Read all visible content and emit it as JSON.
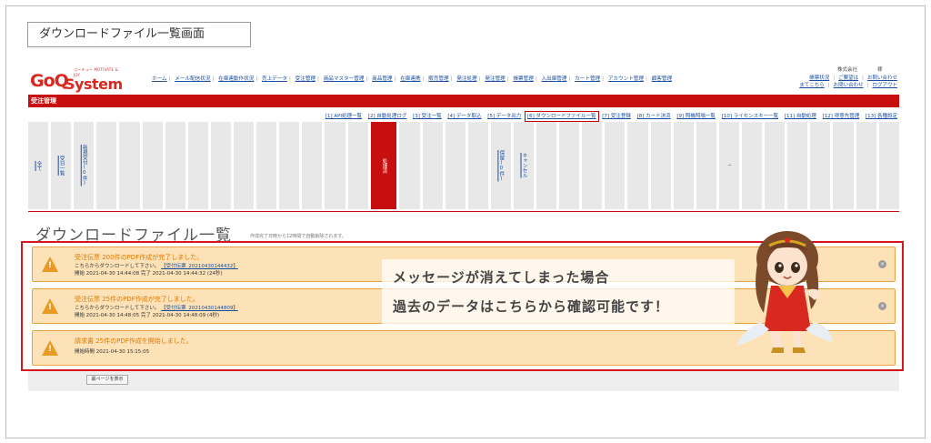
{
  "title": "ダウンロードファイル一覧画面",
  "logo": {
    "text_goq": "GoQ",
    "text_system": "System",
    "tagline": "ゴーキュー  MOTIVATE & JOY"
  },
  "top_nav": [
    "ホーム",
    "メール配信状況",
    "在庫連動作状況",
    "売上データ",
    "受注管理",
    "商品マスター管理",
    "商品管理",
    "在庫連携",
    "販売管理",
    "発注処理",
    "発注管理",
    "帳票管理",
    "入出庫管理",
    "カート管理",
    "アカウント管理",
    "顧客管理"
  ],
  "company": "株式会社　　　　様",
  "right_links": {
    "row1": [
      "帳票状況",
      "ご要望は",
      "お問い合わせ"
    ],
    "row2": [
      "まてこちら",
      "お問い合わせ",
      "ログアウト"
    ]
  },
  "section_title": "受注管理",
  "subnav": [
    "[1] API処理一覧",
    "[2] 自動処理ログ",
    "[3] 受注一覧",
    "[4] データ取込",
    "[5] データ出力",
    "[6] ダウンロードファイル一覧",
    "[7] 受注登録",
    "[8] カード決済",
    "[9] 照機照場一覧",
    "[10] ライセンスキー一覧",
    "[11] 自動処理",
    "[12] 得意先管理",
    "[13] 各種設定"
  ],
  "columns": {
    "c1": "全て",
    "c2": "受日一覧",
    "c3": "新規受付(0件)",
    "processing": "処理済",
    "c5": "保留(0件)",
    "c6": "キャンセル",
    "c7": "─"
  },
  "heading": "ダウンロードファイル一覧",
  "heading_note": "作成完了日時から12時間で自動削除されます。",
  "alerts": [
    {
      "title": "受注伝票 200件のPDF作成が完了しました。",
      "line2_prefix": "こちらからダウンロードして下さい。",
      "link": "【受付伝票_20210430144432】",
      "line3": "開始 2021-04-30 14:44:08 完了 2021-04-30 14:44:32 (24秒)"
    },
    {
      "title": "受注伝票 25件のPDF作成が完了しました。",
      "line2_prefix": "こちらからダウンロードして下さい。",
      "link": "【受付伝票_20210430144809】",
      "line3": "開始 2021-04-30 14:48:05 完了 2021-04-30 14:48:09 (4秒)"
    },
    {
      "title": "請求書 25件のPDF作成を開始しました。",
      "line3": "開始時間 2021-04-30 15:15:05"
    }
  ],
  "callout": {
    "line1": "メッセージが消えてしまった場合",
    "line2": "過去のデータはこちらから確認可能です！"
  },
  "below_button": "最ページを表示",
  "colors": {
    "brand_red": "#c80f0f",
    "alert_bg": "#fde2b7",
    "alert_border": "#e8a23f",
    "link": "#1a4ea0"
  }
}
